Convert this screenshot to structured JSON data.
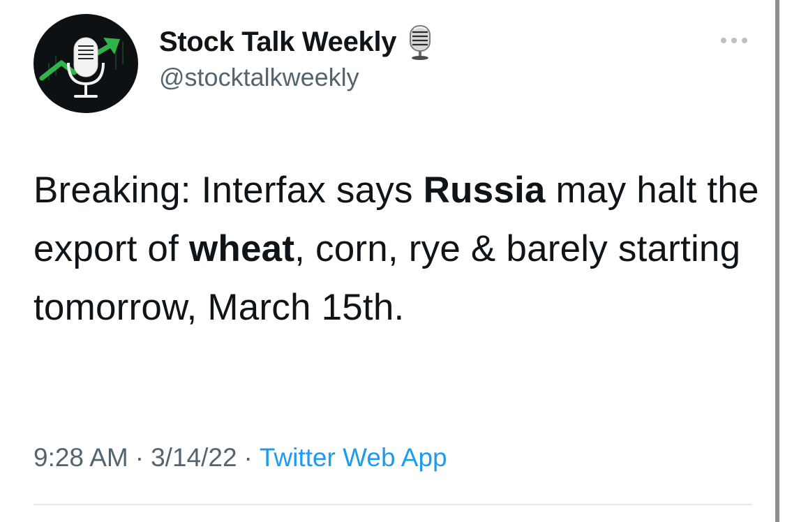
{
  "tweet": {
    "author": {
      "display_name": "Stock Talk Weekly",
      "handle": "@stocktalkweekly",
      "avatar_icon": "microphone-stock-chart-icon",
      "badge_icon": "studio-microphone-emoji"
    },
    "text_segments": [
      {
        "text": "Breaking: Interfax says ",
        "bold": false
      },
      {
        "text": "Russia",
        "bold": true
      },
      {
        "text": " may halt the export of ",
        "bold": false
      },
      {
        "text": "wheat",
        "bold": true
      },
      {
        "text": ", corn, rye & barely starting tomorrow, March 15th.",
        "bold": false
      }
    ],
    "time": "9:28 AM",
    "separator": "·",
    "date": "3/14/22",
    "source": "Twitter Web App",
    "more_icon": "more-options-icon"
  },
  "colors": {
    "text_primary": "#0f1419",
    "text_secondary": "#536471",
    "link": "#1d9bf0",
    "avatar_bg": "#0e1114",
    "avatar_arrow": "#2fb34a"
  }
}
